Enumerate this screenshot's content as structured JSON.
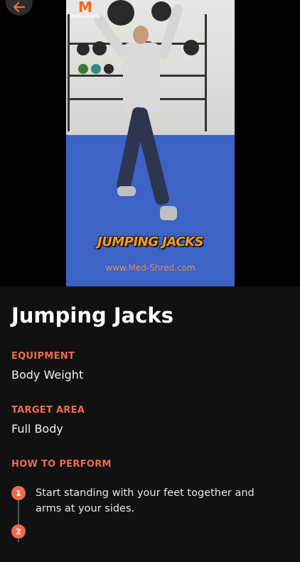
{
  "nav": {
    "back_icon": "arrow-left-icon"
  },
  "video": {
    "logo_mark": "M",
    "logo_text": "MED-SHRED",
    "title_overlay": "JUMPING JACKS",
    "watermark": "www.Med-Shred.com"
  },
  "exercise": {
    "title": "Jumping Jacks",
    "equipment_heading": "EQUIPMENT",
    "equipment_value": "Body Weight",
    "target_heading": "TARGET AREA",
    "target_value": "Full Body",
    "how_heading": "HOW TO PERFORM",
    "steps": [
      {
        "number": "1",
        "text": "Start standing with your feet together and arms at your sides."
      },
      {
        "number": "2",
        "text": ""
      }
    ]
  },
  "colors": {
    "accent": "#ee6a4c",
    "background": "#111111"
  }
}
